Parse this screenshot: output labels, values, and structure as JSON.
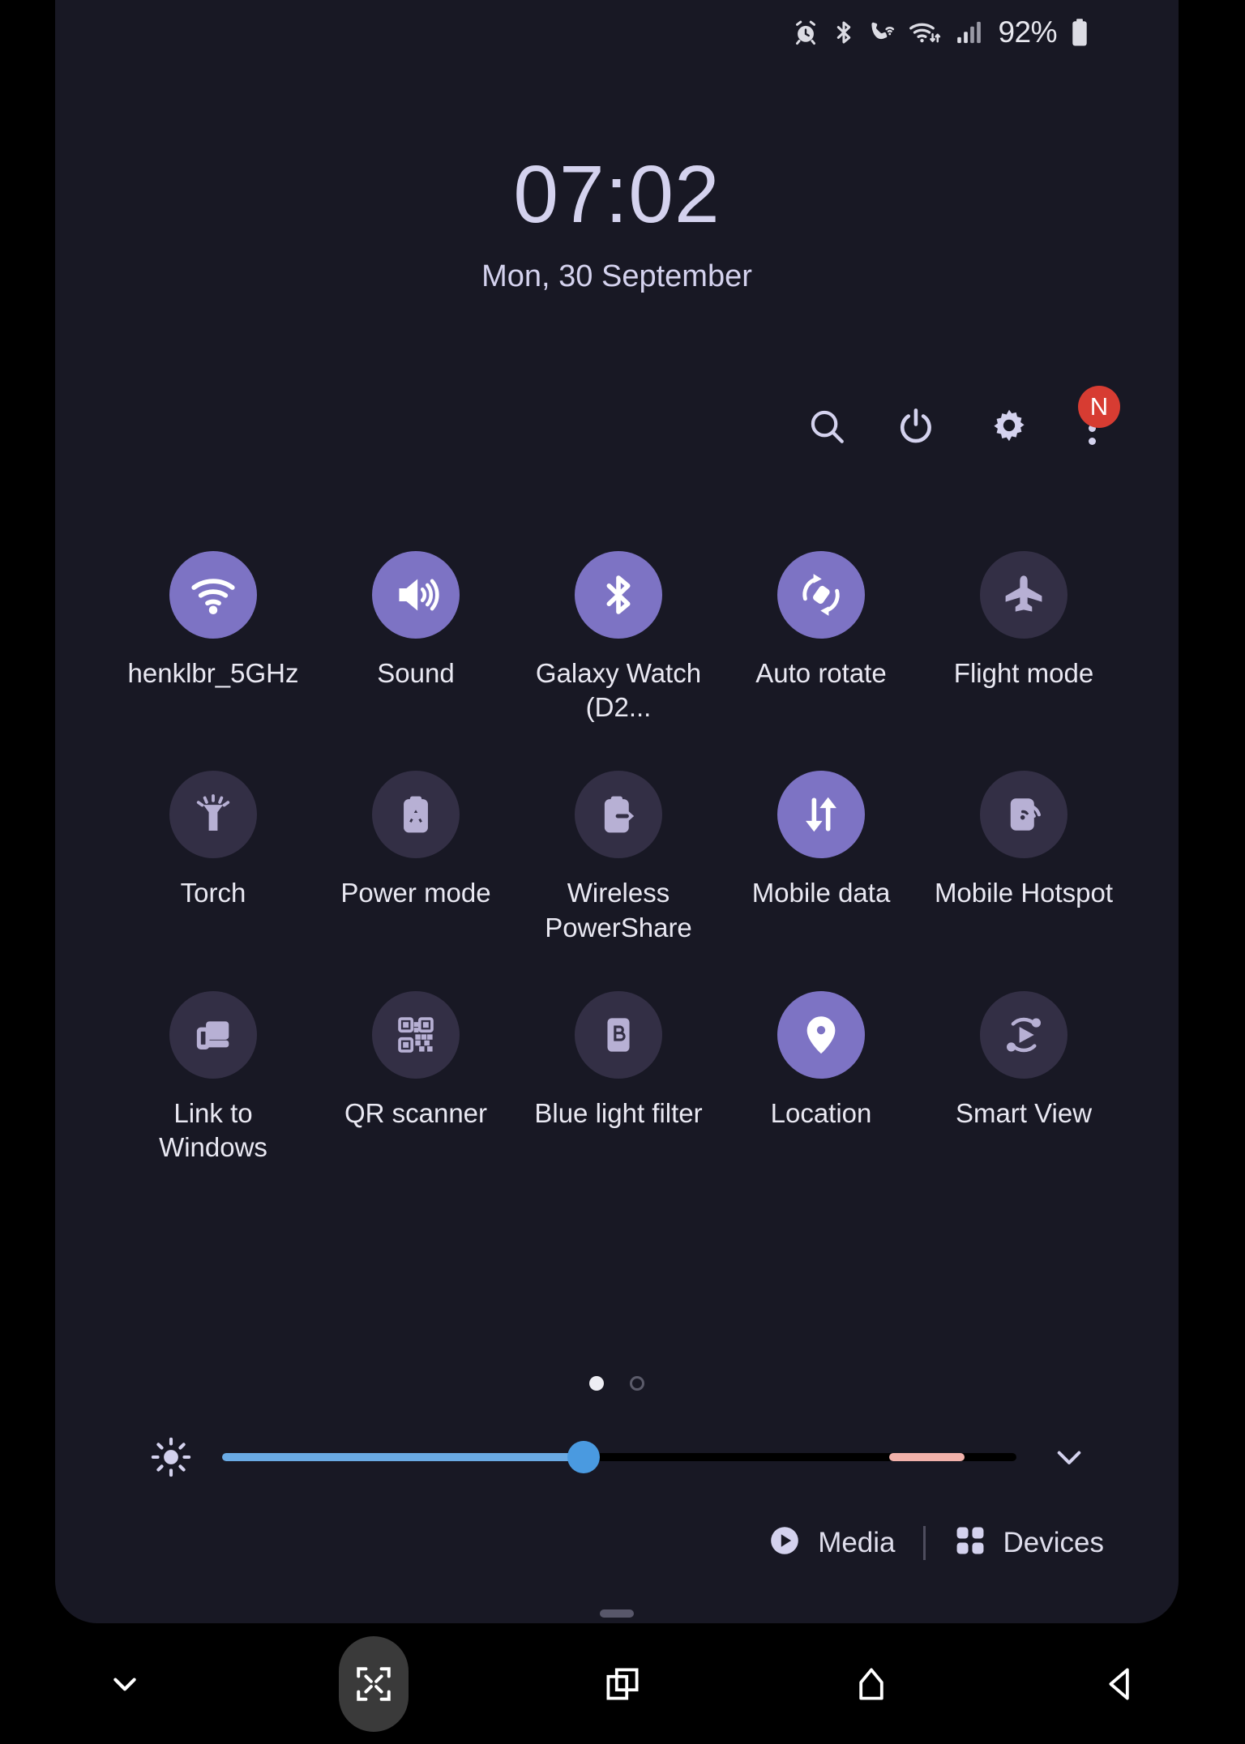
{
  "status_bar": {
    "icons": [
      "alarm-icon",
      "bluetooth-icon",
      "wifi-calling-icon",
      "wifi-data-icon",
      "signal-bars-icon"
    ],
    "battery_percent": "92%",
    "battery_icon": "battery-full-icon"
  },
  "clock": {
    "time": "07:02",
    "date": "Mon, 30 September"
  },
  "header_actions": [
    {
      "name": "search-icon",
      "label": "Search"
    },
    {
      "name": "power-icon",
      "label": "Power"
    },
    {
      "name": "gear-icon",
      "label": "Settings"
    },
    {
      "name": "kebab-menu-icon",
      "label": "More options",
      "badge": "N"
    }
  ],
  "tiles": [
    {
      "label": "henklbr_5GHz",
      "icon": "wifi-icon",
      "state": "on"
    },
    {
      "label": "Sound",
      "icon": "volume-icon",
      "state": "on"
    },
    {
      "label": "Galaxy Watch (D2...",
      "icon": "bluetooth-icon",
      "state": "on"
    },
    {
      "label": "Auto rotate",
      "icon": "auto-rotate-icon",
      "state": "on"
    },
    {
      "label": "Flight mode",
      "icon": "airplane-icon",
      "state": "off"
    },
    {
      "label": "Torch",
      "icon": "flashlight-icon",
      "state": "off"
    },
    {
      "label": "Power mode",
      "icon": "power-mode-icon",
      "state": "off"
    },
    {
      "label": "Wireless PowerShare",
      "icon": "power-share-icon",
      "state": "off"
    },
    {
      "label": "Mobile data",
      "icon": "mobile-data-icon",
      "state": "on"
    },
    {
      "label": "Mobile Hotspot",
      "icon": "hotspot-icon",
      "state": "off"
    },
    {
      "label": "Link to Windows",
      "icon": "link-to-windows-icon",
      "state": "off"
    },
    {
      "label": "QR scanner",
      "icon": "qr-code-icon",
      "state": "off"
    },
    {
      "label": "Blue light filter",
      "icon": "blue-light-icon",
      "state": "off"
    },
    {
      "label": "Location",
      "icon": "location-pin-icon",
      "state": "on"
    },
    {
      "label": "Smart View",
      "icon": "smart-view-icon",
      "state": "off"
    }
  ],
  "pagination": {
    "pages": 2,
    "current": 1
  },
  "brightness": {
    "icon": "brightness-sun-icon",
    "value_percent": 45,
    "warm_segment_percent": 10,
    "expand_icon": "chevron-down-icon"
  },
  "footer": {
    "media_label": "Media",
    "media_icon": "play-circle-icon",
    "devices_label": "Devices",
    "devices_icon": "devices-grid-icon"
  },
  "navbar": [
    {
      "name": "nav-collapse-icon",
      "label": "Collapse"
    },
    {
      "name": "nav-shrink-icon",
      "label": "Shrink screen"
    },
    {
      "name": "nav-recents-icon",
      "label": "Recents"
    },
    {
      "name": "nav-home-icon",
      "label": "Home"
    },
    {
      "name": "nav-back-icon",
      "label": "Back"
    }
  ],
  "colors": {
    "panel_bg": "#181824",
    "accent_on": "#7d73c4",
    "tile_off": "#332f45",
    "badge_red": "#d73c32",
    "slider_blue": "#6aaae4",
    "slider_warm": "#f1b1ab",
    "text": "#e9e8f2"
  }
}
